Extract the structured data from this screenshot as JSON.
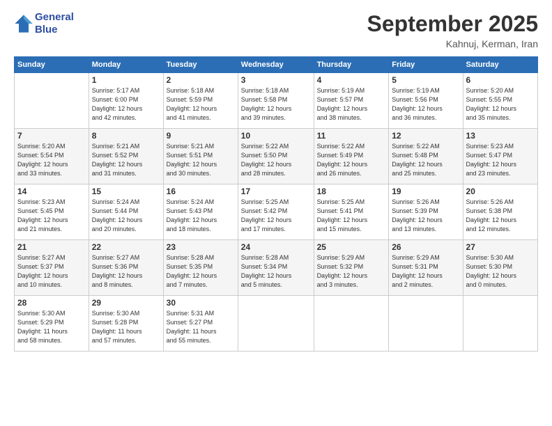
{
  "header": {
    "logo_line1": "General",
    "logo_line2": "Blue",
    "month": "September 2025",
    "location": "Kahnuj, Kerman, Iran"
  },
  "columns": [
    "Sunday",
    "Monday",
    "Tuesday",
    "Wednesday",
    "Thursday",
    "Friday",
    "Saturday"
  ],
  "weeks": [
    [
      {
        "day": "",
        "info": ""
      },
      {
        "day": "1",
        "info": "Sunrise: 5:17 AM\nSunset: 6:00 PM\nDaylight: 12 hours\nand 42 minutes."
      },
      {
        "day": "2",
        "info": "Sunrise: 5:18 AM\nSunset: 5:59 PM\nDaylight: 12 hours\nand 41 minutes."
      },
      {
        "day": "3",
        "info": "Sunrise: 5:18 AM\nSunset: 5:58 PM\nDaylight: 12 hours\nand 39 minutes."
      },
      {
        "day": "4",
        "info": "Sunrise: 5:19 AM\nSunset: 5:57 PM\nDaylight: 12 hours\nand 38 minutes."
      },
      {
        "day": "5",
        "info": "Sunrise: 5:19 AM\nSunset: 5:56 PM\nDaylight: 12 hours\nand 36 minutes."
      },
      {
        "day": "6",
        "info": "Sunrise: 5:20 AM\nSunset: 5:55 PM\nDaylight: 12 hours\nand 35 minutes."
      }
    ],
    [
      {
        "day": "7",
        "info": "Sunrise: 5:20 AM\nSunset: 5:54 PM\nDaylight: 12 hours\nand 33 minutes."
      },
      {
        "day": "8",
        "info": "Sunrise: 5:21 AM\nSunset: 5:52 PM\nDaylight: 12 hours\nand 31 minutes."
      },
      {
        "day": "9",
        "info": "Sunrise: 5:21 AM\nSunset: 5:51 PM\nDaylight: 12 hours\nand 30 minutes."
      },
      {
        "day": "10",
        "info": "Sunrise: 5:22 AM\nSunset: 5:50 PM\nDaylight: 12 hours\nand 28 minutes."
      },
      {
        "day": "11",
        "info": "Sunrise: 5:22 AM\nSunset: 5:49 PM\nDaylight: 12 hours\nand 26 minutes."
      },
      {
        "day": "12",
        "info": "Sunrise: 5:22 AM\nSunset: 5:48 PM\nDaylight: 12 hours\nand 25 minutes."
      },
      {
        "day": "13",
        "info": "Sunrise: 5:23 AM\nSunset: 5:47 PM\nDaylight: 12 hours\nand 23 minutes."
      }
    ],
    [
      {
        "day": "14",
        "info": "Sunrise: 5:23 AM\nSunset: 5:45 PM\nDaylight: 12 hours\nand 21 minutes."
      },
      {
        "day": "15",
        "info": "Sunrise: 5:24 AM\nSunset: 5:44 PM\nDaylight: 12 hours\nand 20 minutes."
      },
      {
        "day": "16",
        "info": "Sunrise: 5:24 AM\nSunset: 5:43 PM\nDaylight: 12 hours\nand 18 minutes."
      },
      {
        "day": "17",
        "info": "Sunrise: 5:25 AM\nSunset: 5:42 PM\nDaylight: 12 hours\nand 17 minutes."
      },
      {
        "day": "18",
        "info": "Sunrise: 5:25 AM\nSunset: 5:41 PM\nDaylight: 12 hours\nand 15 minutes."
      },
      {
        "day": "19",
        "info": "Sunrise: 5:26 AM\nSunset: 5:39 PM\nDaylight: 12 hours\nand 13 minutes."
      },
      {
        "day": "20",
        "info": "Sunrise: 5:26 AM\nSunset: 5:38 PM\nDaylight: 12 hours\nand 12 minutes."
      }
    ],
    [
      {
        "day": "21",
        "info": "Sunrise: 5:27 AM\nSunset: 5:37 PM\nDaylight: 12 hours\nand 10 minutes."
      },
      {
        "day": "22",
        "info": "Sunrise: 5:27 AM\nSunset: 5:36 PM\nDaylight: 12 hours\nand 8 minutes."
      },
      {
        "day": "23",
        "info": "Sunrise: 5:28 AM\nSunset: 5:35 PM\nDaylight: 12 hours\nand 7 minutes."
      },
      {
        "day": "24",
        "info": "Sunrise: 5:28 AM\nSunset: 5:34 PM\nDaylight: 12 hours\nand 5 minutes."
      },
      {
        "day": "25",
        "info": "Sunrise: 5:29 AM\nSunset: 5:32 PM\nDaylight: 12 hours\nand 3 minutes."
      },
      {
        "day": "26",
        "info": "Sunrise: 5:29 AM\nSunset: 5:31 PM\nDaylight: 12 hours\nand 2 minutes."
      },
      {
        "day": "27",
        "info": "Sunrise: 5:30 AM\nSunset: 5:30 PM\nDaylight: 12 hours\nand 0 minutes."
      }
    ],
    [
      {
        "day": "28",
        "info": "Sunrise: 5:30 AM\nSunset: 5:29 PM\nDaylight: 11 hours\nand 58 minutes."
      },
      {
        "day": "29",
        "info": "Sunrise: 5:30 AM\nSunset: 5:28 PM\nDaylight: 11 hours\nand 57 minutes."
      },
      {
        "day": "30",
        "info": "Sunrise: 5:31 AM\nSunset: 5:27 PM\nDaylight: 11 hours\nand 55 minutes."
      },
      {
        "day": "",
        "info": ""
      },
      {
        "day": "",
        "info": ""
      },
      {
        "day": "",
        "info": ""
      },
      {
        "day": "",
        "info": ""
      }
    ]
  ]
}
